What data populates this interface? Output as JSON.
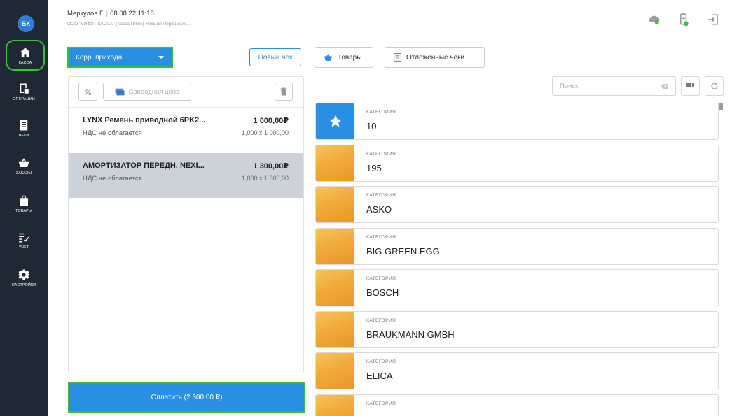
{
  "sidebar": {
    "avatar": "БК",
    "items": [
      {
        "label": "КАССА",
        "icon": "home-icon"
      },
      {
        "label": "ОПЕРАЦИИ",
        "icon": "operations-icon"
      },
      {
        "label": "ЧЕКИ",
        "icon": "receipts-icon"
      },
      {
        "label": "ЗАКАЗЫ",
        "icon": "orders-basket-icon"
      },
      {
        "label": "ТОВАРЫ",
        "icon": "products-bag-icon"
      },
      {
        "label": "УЧЁТ",
        "icon": "accounting-checklist-icon"
      },
      {
        "label": "НАСТРОЙКИ",
        "icon": "gear-icon"
      }
    ]
  },
  "header": {
    "user": "Меркулов Г.",
    "datetime": "08.08.22 11:18",
    "org": "ООО \"БИФИТ КАССА\" (Касса Плюс) Нижняя Первомайс..."
  },
  "controls": {
    "operation_type": "Корр. прихода",
    "new_check": "Новый чек",
    "goods": "Товары",
    "postponed": "Отложенные чеки"
  },
  "receipt": {
    "free_price": "Свободная цена",
    "items": [
      {
        "name": "LYNX Ремень приводной 6PK2...",
        "tax": "НДС не облагается",
        "price": "1 000,00₽",
        "qty": "1,000 x 1 000,00"
      },
      {
        "name": "АМОРТИЗАТОР ПЕРЕДН. NEXI...",
        "tax": "НДС не облагается",
        "price": "1 300,00₽",
        "qty": "1,000 x 1 300,00"
      }
    ],
    "pay_button": "Оплатить (2 300,00 ₽)"
  },
  "search": {
    "placeholder": "Поиск"
  },
  "categories": [
    {
      "kind": "КАТЕГОРИЯ",
      "name": "10"
    },
    {
      "kind": "КАТЕГОРИЯ",
      "name": "195"
    },
    {
      "kind": "КАТЕГОРИЯ",
      "name": "ASKO"
    },
    {
      "kind": "КАТЕГОРИЯ",
      "name": "BIG GREEN EGG"
    },
    {
      "kind": "КАТЕГОРИЯ",
      "name": "BOSCH"
    },
    {
      "kind": "КАТЕГОРИЯ",
      "name": "BRAUKMANN GMBH"
    },
    {
      "kind": "КАТЕГОРИЯ",
      "name": "ELICA"
    },
    {
      "kind": "КАТЕГОРИЯ",
      "name": ""
    }
  ],
  "colors": {
    "accent": "#2a8fe3",
    "highlight": "#35c23a",
    "sidebar": "#1f2833",
    "selected_row": "#cdd2d9",
    "category_thumb": "#f1ab3b"
  }
}
